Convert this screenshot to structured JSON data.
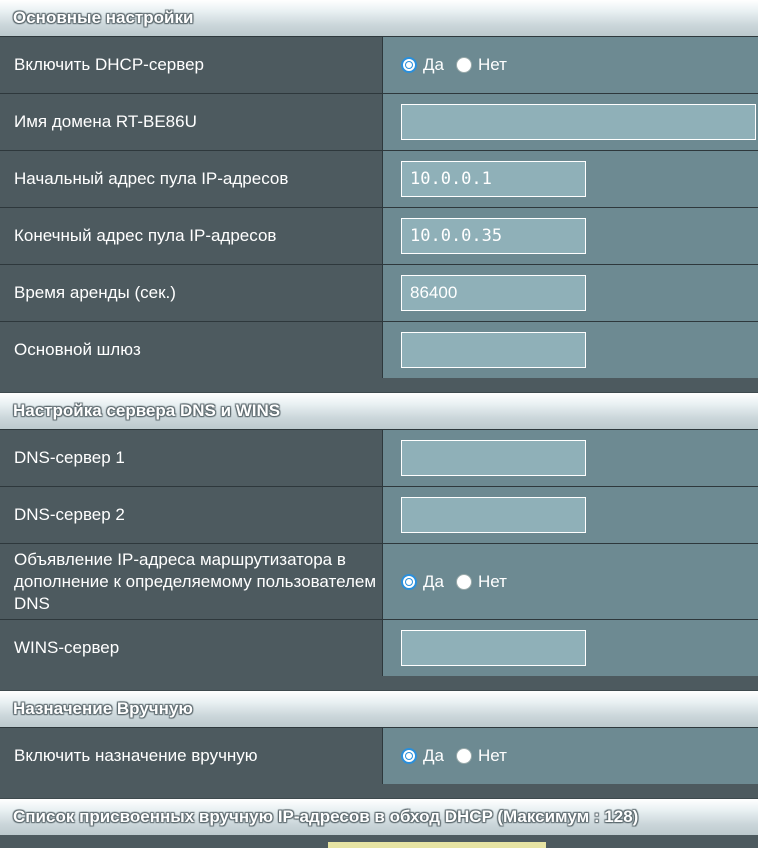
{
  "sections": {
    "basic": {
      "title": "Основные настройки",
      "dhcp_enable": {
        "label": "Включить DHCP-сервер",
        "yes": "Да",
        "no": "Нет",
        "selected": "yes"
      },
      "domain_name": {
        "label": "Имя домена RT-BE86U",
        "value": ""
      },
      "pool_start": {
        "label": "Начальный адрес пула IP-адресов",
        "value": "10.0.0.1"
      },
      "pool_end": {
        "label": "Конечный адрес пула IP-адресов",
        "value": "10.0.0.35"
      },
      "lease_time": {
        "label": "Время аренды (сек.)",
        "value": "86400"
      },
      "gateway": {
        "label": "Основной шлюз",
        "value": ""
      }
    },
    "dns_wins": {
      "title": "Настройка сервера DNS и WINS",
      "dns1": {
        "label": "DNS-сервер 1",
        "value": ""
      },
      "dns2": {
        "label": "DNS-сервер 2",
        "value": ""
      },
      "advertise": {
        "label": "Объявление IP-адреса маршрутизатора в дополнение к определяемому пользователем DNS",
        "yes": "Да",
        "no": "Нет",
        "selected": "yes"
      },
      "wins": {
        "label": "WINS-сервер",
        "value": ""
      }
    },
    "manual": {
      "title": "Назначение Вручную",
      "enable": {
        "label": "Включить назначение вручную",
        "yes": "Да",
        "no": "Нет",
        "selected": "yes"
      }
    },
    "list": {
      "title": "Список присвоенных вручную IP-адресов в обход DHCP (Максимум : 128)"
    }
  },
  "colors": {
    "accent": "#2a8fdb",
    "label_bg": "#4d5a5f",
    "control_bg": "#6d8a92",
    "input_bg": "#8fb0b8"
  }
}
